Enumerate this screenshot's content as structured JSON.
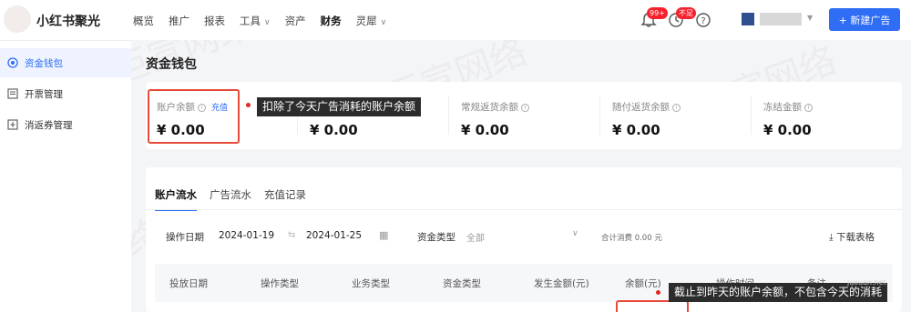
{
  "header": {
    "app_title": "小红书聚光",
    "nav": [
      {
        "label": "概览",
        "has_caret": false,
        "active": false
      },
      {
        "label": "推广",
        "has_caret": false,
        "active": false
      },
      {
        "label": "报表",
        "has_caret": false,
        "active": false
      },
      {
        "label": "工具",
        "has_caret": true,
        "active": false
      },
      {
        "label": "资产",
        "has_caret": false,
        "active": false
      },
      {
        "label": "财务",
        "has_caret": false,
        "active": true
      },
      {
        "label": "灵犀",
        "has_caret": true,
        "active": false
      }
    ],
    "notification_badge": "99+",
    "message_badge": "不足",
    "new_ad_button": "+ 新建广告",
    "accent_color": "#2f6df5"
  },
  "sidebar": {
    "items": [
      {
        "label": "资金钱包",
        "icon": "wallet-icon",
        "active": true
      },
      {
        "label": "开票管理",
        "icon": "invoice-icon",
        "active": false
      },
      {
        "label": "消返券管理",
        "icon": "coupon-icon",
        "active": false
      }
    ]
  },
  "main": {
    "page_title": "资金钱包",
    "balances": [
      {
        "label": "账户余额",
        "value": "¥ 0.00",
        "link": "充值"
      },
      {
        "label": "",
        "value": "¥ 0.00",
        "link": ""
      },
      {
        "label": "常规返货余额",
        "value": "¥ 0.00",
        "link": ""
      },
      {
        "label": "随付返货余额",
        "value": "¥ 0.00",
        "link": ""
      },
      {
        "label": "冻结金额",
        "value": "¥ 0.00",
        "link": ""
      }
    ],
    "tooltip_top": "扣除了今天广告消耗的账户余额",
    "tooltip_bottom": "截止到昨天的账户余额，不包含今天的消耗",
    "tabs": [
      "账户流水",
      "广告流水",
      "充值记录"
    ],
    "filter": {
      "date_label": "操作日期",
      "date_start": "2024-01-19",
      "date_end": "2024-01-25",
      "fund_type_label": "资金类型",
      "fund_type_value": "全部",
      "total_text": "合计消费 0.00 元",
      "download_label": "下载表格"
    },
    "table_headers": [
      "投放日期",
      "操作类型",
      "业务类型",
      "资金类型",
      "发生金额(元)",
      "余额(元)",
      "操作时间",
      "备注"
    ]
  },
  "watermarks": [
    "巨宣网络",
    "巨宣网络",
    "巨宣网络",
    "巨宣网络"
  ],
  "watermark_site": "juxuan.net"
}
